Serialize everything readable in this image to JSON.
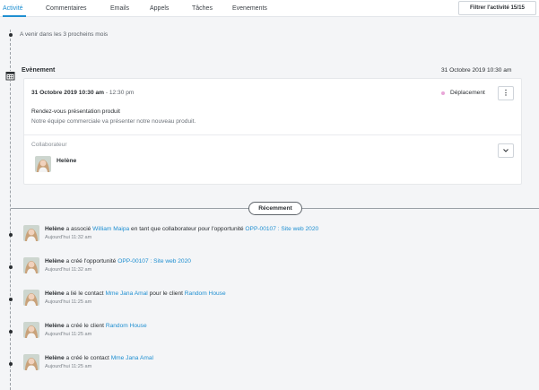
{
  "tabs": [
    {
      "label": "Activité",
      "active": true
    },
    {
      "label": "Commentaires",
      "active": false
    },
    {
      "label": "Emails",
      "active": false
    },
    {
      "label": "Appels",
      "active": false
    },
    {
      "label": "Tâches",
      "active": false
    },
    {
      "label": "Evenements",
      "active": false
    }
  ],
  "filter_button": "Filtrer l'activité 15/15",
  "upcoming_label": "A venir dans les 3 procheins mois",
  "event": {
    "type": "Evènement",
    "date": "31 Octobre 2019 10:30 am",
    "start": "31 Octobre 2019 10:30 am",
    "end": "- 12:30 pm",
    "category": "Déplacement",
    "category_color": "#e9a6d8",
    "subject": "Rendez-vous présentation produit",
    "description": "Notre équipe commerciale va présenter notre nouveau produit.",
    "collaborator_label": "Collaborateur",
    "collaborator_name": "Helène"
  },
  "recent_label": "Récemment",
  "activities": [
    {
      "user": "Helène",
      "parts": [
        {
          "text": "a associé ",
          "link": false
        },
        {
          "text": "William Maipa",
          "link": true
        },
        {
          "text": " en tant que collaborateur pour l'opportunité ",
          "link": false
        },
        {
          "text": "OPP-00107 : Site web 2020",
          "link": true
        }
      ],
      "time": "Aujourd'hui 11:32 am"
    },
    {
      "user": "Helène",
      "parts": [
        {
          "text": "a créé l'opportunité ",
          "link": false
        },
        {
          "text": "OPP-00107 : Site web 2020",
          "link": true
        }
      ],
      "time": "Aujourd'hui 11:32 am"
    },
    {
      "user": "Helène",
      "parts": [
        {
          "text": "a lié le contact ",
          "link": false
        },
        {
          "text": "Mme Jana Amal",
          "link": true
        },
        {
          "text": " pour le client ",
          "link": false
        },
        {
          "text": "Random House",
          "link": true
        }
      ],
      "time": "Aujourd'hui 11:25 am"
    },
    {
      "user": "Helène",
      "parts": [
        {
          "text": "a créé le client ",
          "link": false
        },
        {
          "text": "Random House",
          "link": true
        }
      ],
      "time": "Aujourd'hui 11:25 am"
    },
    {
      "user": "Helène",
      "parts": [
        {
          "text": "a créé le contact ",
          "link": false
        },
        {
          "text": "Mme Jana Amal",
          "link": true
        }
      ],
      "time": "Aujourd'hui 11:25 am"
    }
  ],
  "colors": {
    "accent": "#1f8fd1",
    "link": "#1f8fd1",
    "text": "#2b2f33"
  }
}
